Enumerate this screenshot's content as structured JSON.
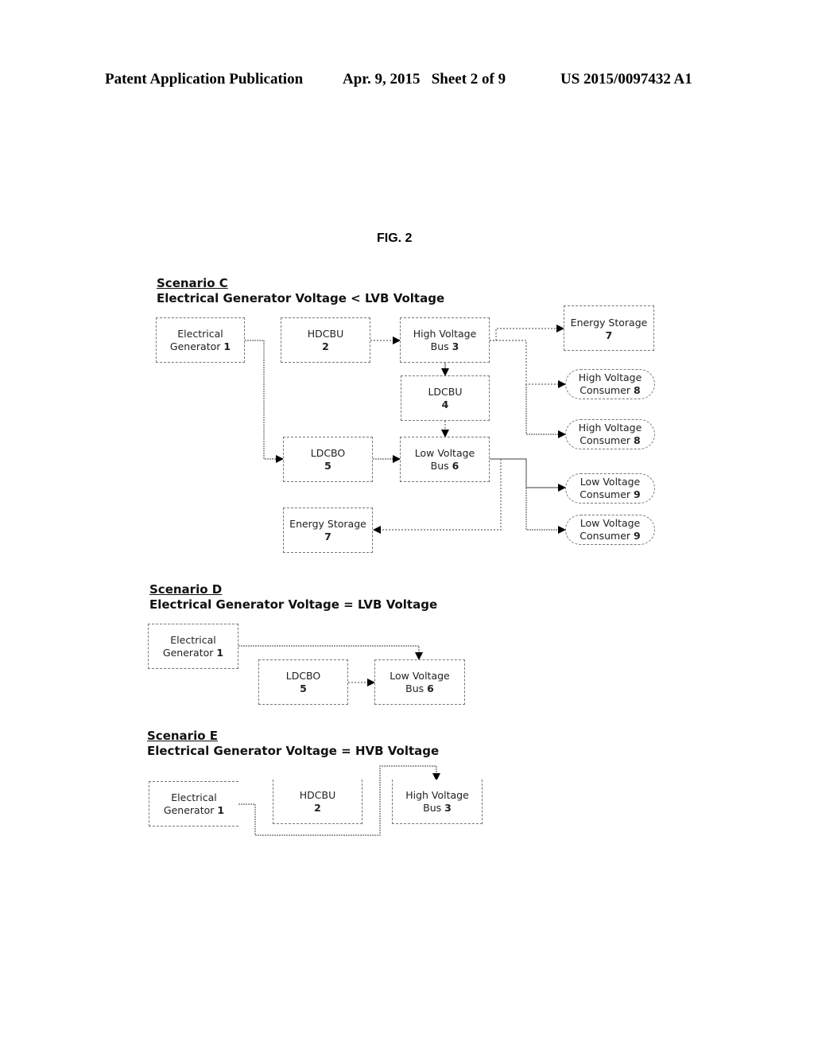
{
  "header": {
    "publication": "Patent Application Publication",
    "date_sheet": "Apr. 9, 2015   Sheet 2 of 9",
    "number": "US 2015/0097432 A1"
  },
  "figure_label": "FIG. 2",
  "scenarios": [
    {
      "id": "C",
      "title": "Scenario C",
      "subtitle": "Electrical Generator Voltage < LVB Voltage",
      "nodes": [
        {
          "key": "gen",
          "label": "Electrical Generator",
          "num": "1",
          "shape": "rect"
        },
        {
          "key": "hdcbu",
          "label": "HDCBU",
          "num": "2",
          "shape": "rect"
        },
        {
          "key": "hvb",
          "label": "High Voltage Bus",
          "num": "3",
          "shape": "rect"
        },
        {
          "key": "es_top",
          "label": "Energy Storage",
          "num": "7",
          "shape": "rect"
        },
        {
          "key": "hvc1",
          "label": "High Voltage Consumer",
          "num": "8",
          "shape": "pill"
        },
        {
          "key": "ldcbu",
          "label": "LDCBU",
          "num": "4",
          "shape": "rect"
        },
        {
          "key": "hvc2",
          "label": "High Voltage Consumer",
          "num": "8",
          "shape": "pill"
        },
        {
          "key": "ldcbo",
          "label": "LDCBO",
          "num": "5",
          "shape": "rect"
        },
        {
          "key": "lvb",
          "label": "Low Voltage Bus",
          "num": "6",
          "shape": "rect"
        },
        {
          "key": "lvc1",
          "label": "Low Voltage Consumer",
          "num": "9",
          "shape": "pill"
        },
        {
          "key": "es_bottom",
          "label": "Energy Storage",
          "num": "7",
          "shape": "rect"
        },
        {
          "key": "lvc2",
          "label": "Low Voltage Consumer",
          "num": "9",
          "shape": "pill"
        }
      ],
      "edges": [
        [
          "gen",
          "ldcbo"
        ],
        [
          "hdcbu",
          "hvb"
        ],
        [
          "hvb",
          "es_top"
        ],
        [
          "hvb",
          "hvc1"
        ],
        [
          "hvb",
          "hvc2"
        ],
        [
          "hvb",
          "ldcbu"
        ],
        [
          "ldcbu",
          "lvb"
        ],
        [
          "ldcbo",
          "lvb"
        ],
        [
          "lvb",
          "lvc1"
        ],
        [
          "lvb",
          "lvc2"
        ],
        [
          "lvb",
          "es_bottom"
        ]
      ]
    },
    {
      "id": "D",
      "title": "Scenario D",
      "subtitle": "Electrical Generator Voltage = LVB Voltage",
      "nodes": [
        {
          "key": "gen",
          "label": "Electrical Generator",
          "num": "1",
          "shape": "rect"
        },
        {
          "key": "ldcbo",
          "label": "LDCBO",
          "num": "5",
          "shape": "rect"
        },
        {
          "key": "lvb",
          "label": "Low Voltage Bus",
          "num": "6",
          "shape": "rect"
        }
      ],
      "edges": [
        [
          "gen",
          "lvb"
        ],
        [
          "ldcbo",
          "lvb"
        ]
      ]
    },
    {
      "id": "E",
      "title": "Scenario E",
      "subtitle": "Electrical Generator Voltage = HVB Voltage",
      "nodes": [
        {
          "key": "gen",
          "label": "Electrical Generator",
          "num": "1",
          "shape": "rect"
        },
        {
          "key": "hdcbu",
          "label": "HDCBU",
          "num": "2",
          "shape": "rect"
        },
        {
          "key": "hvb",
          "label": "High Voltage Bus",
          "num": "3",
          "shape": "rect"
        }
      ],
      "edges": [
        [
          "gen",
          "hvb"
        ]
      ]
    }
  ]
}
